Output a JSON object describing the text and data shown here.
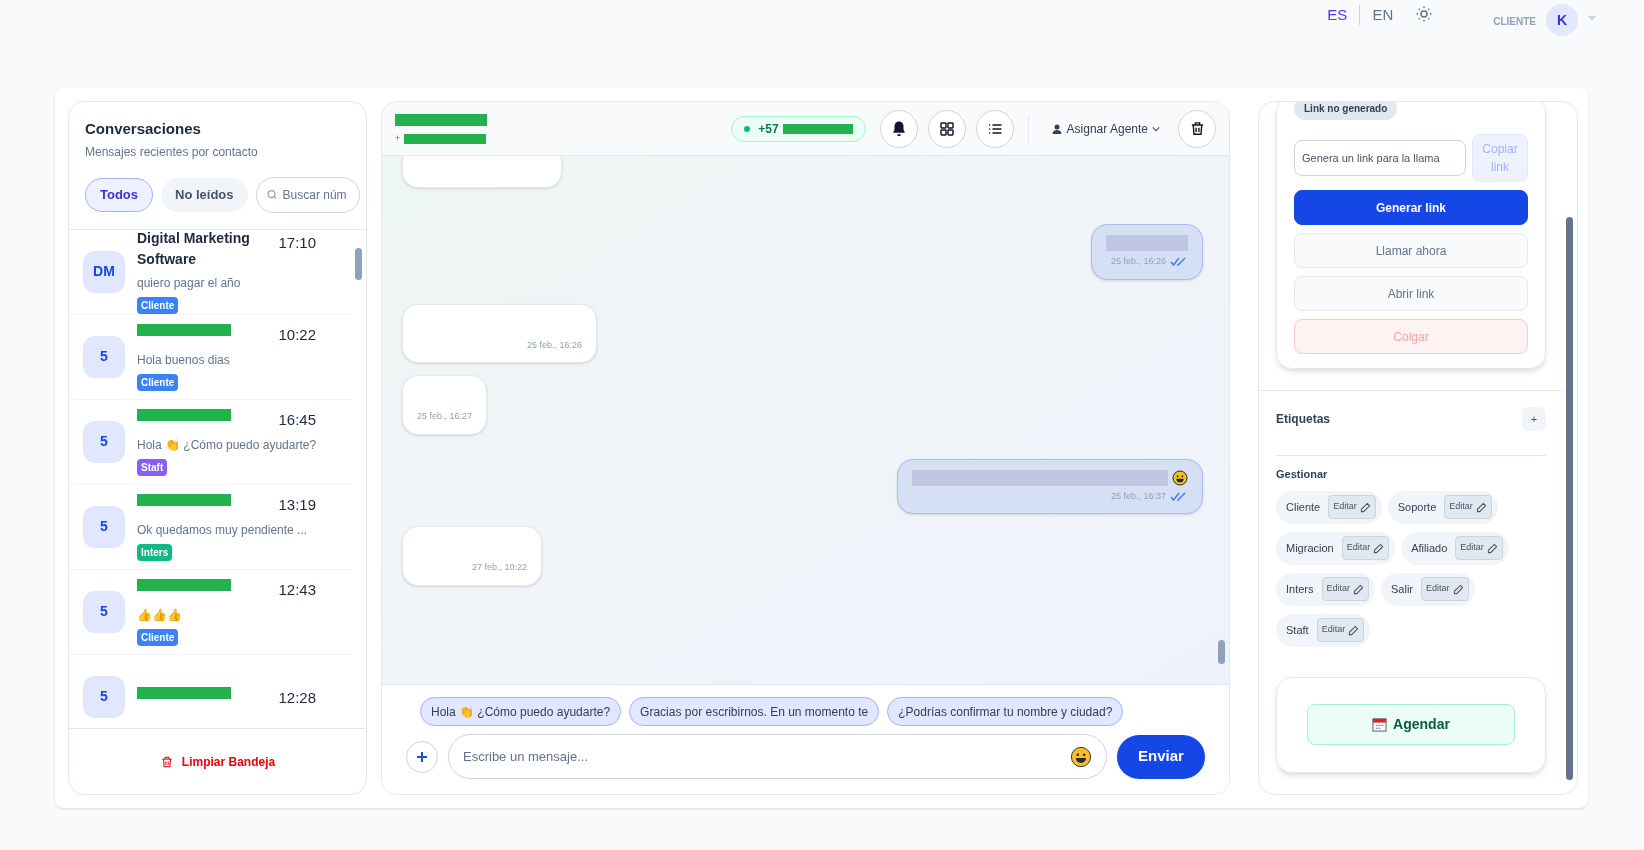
{
  "topbar": {
    "languages": [
      {
        "label": "ES",
        "selected": true
      },
      {
        "label": "EN",
        "selected": false
      }
    ],
    "role": "CLIENTE",
    "avatar": "K"
  },
  "conversations_panel": {
    "title": "Conversaciones",
    "subtitle": "Mensajes recientes por contacto",
    "filters": [
      {
        "label": "Todos",
        "selected": true
      },
      {
        "label": "No leídos",
        "selected": false
      }
    ],
    "search": {
      "placeholder": "Buscar núm"
    },
    "items": [
      {
        "kind": "named",
        "avatar": "DM",
        "name": "Digital Marketing Software",
        "time": "17:10",
        "preview": "quiero pagar el año",
        "tag": {
          "label": "Cliente",
          "color": "#3b82f6"
        }
      },
      {
        "kind": "redacted",
        "avatar": "5",
        "time": "10:22",
        "preview": "Hola buenos dias",
        "tag": {
          "label": "Cliente",
          "color": "#3b82f6"
        }
      },
      {
        "kind": "redacted",
        "avatar": "5",
        "time": "16:45",
        "preview": "Hola 👏 ¿Cómo puedo ayudarte?",
        "tag": {
          "label": "Staft",
          "color": "#8b5cf6"
        }
      },
      {
        "kind": "redacted",
        "avatar": "5",
        "time": "13:19",
        "preview": "Ok quedamos muy pendiente ...",
        "tag": {
          "label": "Inters",
          "color": "#10b981"
        }
      },
      {
        "kind": "redacted",
        "avatar": "5",
        "time": "12:43",
        "preview": "👍👍👍",
        "tag": {
          "label": "Cliente",
          "color": "#3b82f6"
        }
      },
      {
        "kind": "redacted",
        "avatar": "5",
        "time": "12:28"
      }
    ],
    "clear_button": "Limpiar Bandeja"
  },
  "chat": {
    "header": {
      "number_prefix": "+",
      "phone_prefix": "+57",
      "assign": "Asignar Agente"
    },
    "messages": [
      {
        "outgoing": false,
        "kind": "partial"
      },
      {
        "outgoing": true,
        "kind": "redacted",
        "time": "25 feb., 16:26",
        "read": true
      },
      {
        "outgoing": false,
        "kind": "blank",
        "time": "25 feb., 16:26"
      },
      {
        "outgoing": false,
        "kind": "blank",
        "time": "25 feb., 16:27"
      },
      {
        "outgoing": true,
        "kind": "redacted",
        "smiley": true,
        "time": "25 feb., 16:37",
        "read": true
      },
      {
        "outgoing": false,
        "kind": "blank",
        "time": "27 feb., 10:22"
      }
    ],
    "quick_replies": [
      "Hola 👏 ¿Cómo puedo ayudarte?",
      "Gracias por escribirnos. En un momento te",
      "¿Podrías confirmar tu nombre y ciudad?"
    ],
    "composer": {
      "placeholder": "Escribe un mensaje...",
      "send": "Enviar"
    }
  },
  "side_panel": {
    "link_status": "Link no generado",
    "link_field": {
      "placeholder": "Genera un link para la llama"
    },
    "buttons": [
      {
        "label": "Copiar link",
        "kind": "soft"
      },
      {
        "label": "Generar link",
        "kind": "primary"
      },
      {
        "label": "Llamar ahora",
        "kind": "muted"
      },
      {
        "label": "Abrir link",
        "kind": "muted"
      },
      {
        "label": "Colgar",
        "kind": "danger"
      }
    ],
    "tags_title": "Etiquetas",
    "add": "+",
    "manage_title": "Gestionar",
    "tags": [
      {
        "label": "Cliente",
        "action": "Editar"
      },
      {
        "label": "Soporte",
        "action": "Editar"
      },
      {
        "label": "Migracion",
        "action": "Editar"
      },
      {
        "label": "Afiliado",
        "action": "Editar"
      },
      {
        "label": "Inters",
        "action": "Editar"
      },
      {
        "label": "Salir",
        "action": "Editar"
      },
      {
        "label": "Staft",
        "action": "Editar"
      }
    ],
    "schedule": "Agendar"
  }
}
